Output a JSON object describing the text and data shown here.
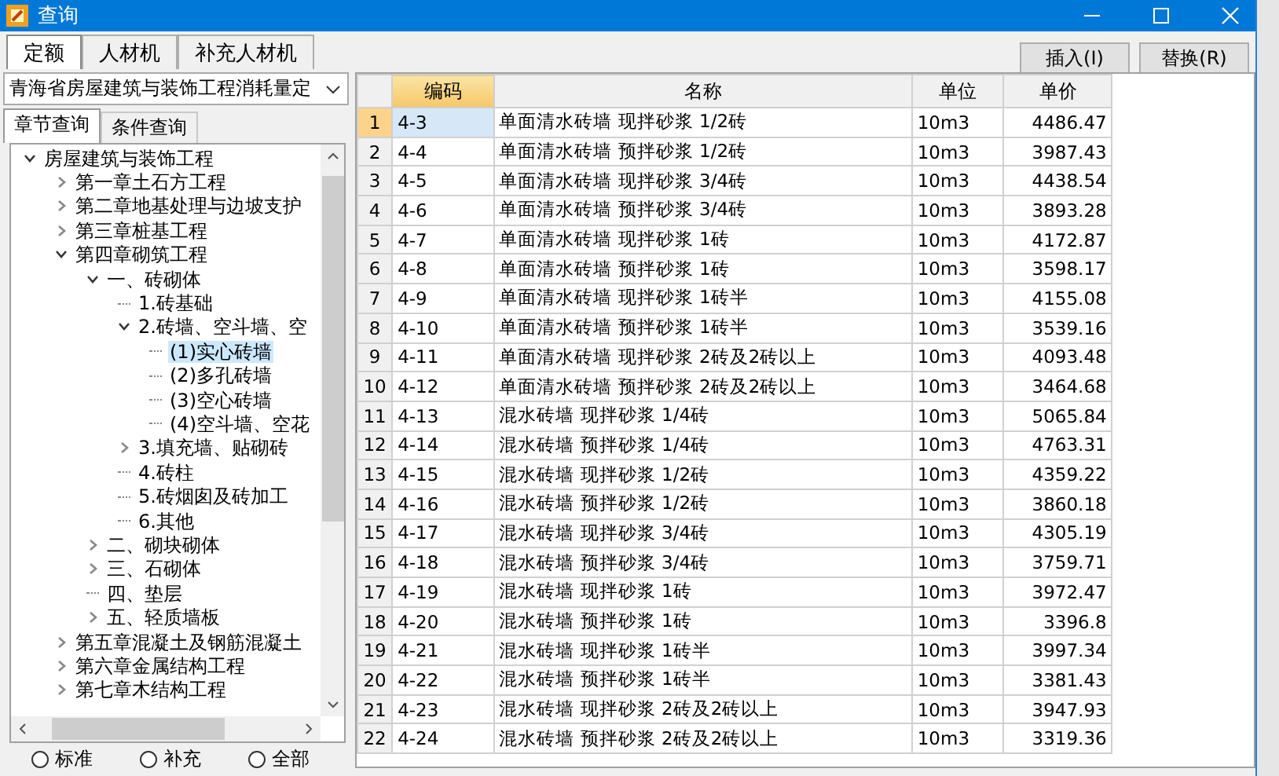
{
  "window": {
    "title": "查询"
  },
  "tabs": [
    {
      "label": "定额",
      "selected": true
    },
    {
      "label": "人材机",
      "selected": false
    },
    {
      "label": "补充人材机",
      "selected": false
    }
  ],
  "buttons": [
    "插入(I)",
    "替换(R)"
  ],
  "library_select": {
    "value": "青海省房屋建筑与装饰工程消耗量定"
  },
  "query_tabs": [
    {
      "label": "章节查询",
      "selected": true
    },
    {
      "label": "条件查询",
      "selected": false
    }
  ],
  "tree": [
    {
      "label": "房屋建筑与装饰工程",
      "expanded": true,
      "selected": false,
      "children": [
        {
          "label": "第一章土石方工程",
          "expanded": false,
          "selected": false
        },
        {
          "label": "第二章地基处理与边坡支护",
          "expanded": false,
          "selected": false
        },
        {
          "label": "第三章桩基工程",
          "expanded": false,
          "selected": false
        },
        {
          "label": "第四章砌筑工程",
          "expanded": true,
          "selected": false,
          "children": [
            {
              "label": "一、砖砌体",
              "expanded": true,
              "selected": false,
              "children": [
                {
                  "label": "1.砖基础",
                  "selected": false
                },
                {
                  "label": "2.砖墙、空斗墙、空",
                  "expanded": true,
                  "selected": false,
                  "children": [
                    {
                      "label": "(1)实心砖墙",
                      "selected": true
                    },
                    {
                      "label": "(2)多孔砖墙",
                      "selected": false
                    },
                    {
                      "label": "(3)空心砖墙",
                      "selected": false
                    },
                    {
                      "label": "(4)空斗墙、空花",
                      "selected": false
                    }
                  ]
                },
                {
                  "label": "3.填充墙、贴砌砖",
                  "expanded": false,
                  "selected": false
                },
                {
                  "label": "4.砖柱",
                  "selected": false
                },
                {
                  "label": "5.砖烟囱及砖加工",
                  "selected": false
                },
                {
                  "label": "6.其他",
                  "selected": false
                }
              ]
            },
            {
              "label": "二、砌块砌体",
              "expanded": false,
              "selected": false
            },
            {
              "label": "三、石砌体",
              "expanded": false,
              "selected": false
            },
            {
              "label": "四、垫层",
              "selected": false
            },
            {
              "label": "五、轻质墙板",
              "expanded": false,
              "selected": false
            }
          ]
        },
        {
          "label": "第五章混凝土及钢筋混凝土",
          "expanded": false,
          "selected": false
        },
        {
          "label": "第六章金属结构工程",
          "expanded": false,
          "selected": false
        },
        {
          "label": "第七章木结构工程",
          "expanded": false,
          "selected": false
        }
      ]
    }
  ],
  "filters": [
    {
      "label": "标准",
      "selected": false
    },
    {
      "label": "补充",
      "selected": false
    },
    {
      "label": "全部",
      "selected": false
    }
  ],
  "table": {
    "columns": [
      {
        "label": "编码",
        "selected": true
      },
      {
        "label": "名称",
        "selected": false
      },
      {
        "label": "单位",
        "selected": false
      },
      {
        "label": "单价",
        "selected": false
      }
    ],
    "rows": [
      {
        "index": "1",
        "code": "4-3",
        "name": "单面清水砖墙 现拌砂浆 1/2砖",
        "unit": "10m3",
        "price": "4486.47",
        "selected": true
      },
      {
        "index": "2",
        "code": "4-4",
        "name": "单面清水砖墙 预拌砂浆 1/2砖",
        "unit": "10m3",
        "price": "3987.43",
        "selected": false
      },
      {
        "index": "3",
        "code": "4-5",
        "name": "单面清水砖墙 现拌砂浆 3/4砖",
        "unit": "10m3",
        "price": "4438.54",
        "selected": false
      },
      {
        "index": "4",
        "code": "4-6",
        "name": "单面清水砖墙 预拌砂浆 3/4砖",
        "unit": "10m3",
        "price": "3893.28",
        "selected": false
      },
      {
        "index": "5",
        "code": "4-7",
        "name": "单面清水砖墙 现拌砂浆 1砖",
        "unit": "10m3",
        "price": "4172.87",
        "selected": false
      },
      {
        "index": "6",
        "code": "4-8",
        "name": "单面清水砖墙 预拌砂浆 1砖",
        "unit": "10m3",
        "price": "3598.17",
        "selected": false
      },
      {
        "index": "7",
        "code": "4-9",
        "name": "单面清水砖墙 现拌砂浆 1砖半",
        "unit": "10m3",
        "price": "4155.08",
        "selected": false
      },
      {
        "index": "8",
        "code": "4-10",
        "name": "单面清水砖墙 预拌砂浆 1砖半",
        "unit": "10m3",
        "price": "3539.16",
        "selected": false
      },
      {
        "index": "9",
        "code": "4-11",
        "name": "单面清水砖墙 现拌砂浆 2砖及2砖以上",
        "unit": "10m3",
        "price": "4093.48",
        "selected": false
      },
      {
        "index": "10",
        "code": "4-12",
        "name": "单面清水砖墙 预拌砂浆 2砖及2砖以上",
        "unit": "10m3",
        "price": "3464.68",
        "selected": false
      },
      {
        "index": "11",
        "code": "4-13",
        "name": "混水砖墙 现拌砂浆 1/4砖",
        "unit": "10m3",
        "price": "5065.84",
        "selected": false
      },
      {
        "index": "12",
        "code": "4-14",
        "name": "混水砖墙 预拌砂浆 1/4砖",
        "unit": "10m3",
        "price": "4763.31",
        "selected": false
      },
      {
        "index": "13",
        "code": "4-15",
        "name": "混水砖墙 现拌砂浆 1/2砖",
        "unit": "10m3",
        "price": "4359.22",
        "selected": false
      },
      {
        "index": "14",
        "code": "4-16",
        "name": "混水砖墙 预拌砂浆 1/2砖",
        "unit": "10m3",
        "price": "3860.18",
        "selected": false
      },
      {
        "index": "15",
        "code": "4-17",
        "name": "混水砖墙 现拌砂浆 3/4砖",
        "unit": "10m3",
        "price": "4305.19",
        "selected": false
      },
      {
        "index": "16",
        "code": "4-18",
        "name": "混水砖墙 预拌砂浆 3/4砖",
        "unit": "10m3",
        "price": "3759.71",
        "selected": false
      },
      {
        "index": "17",
        "code": "4-19",
        "name": "混水砖墙 现拌砂浆 1砖",
        "unit": "10m3",
        "price": "3972.47",
        "selected": false
      },
      {
        "index": "18",
        "code": "4-20",
        "name": "混水砖墙 预拌砂浆 1砖",
        "unit": "10m3",
        "price": "3396.8",
        "selected": false
      },
      {
        "index": "19",
        "code": "4-21",
        "name": "混水砖墙 现拌砂浆 1砖半",
        "unit": "10m3",
        "price": "3997.34",
        "selected": false
      },
      {
        "index": "20",
        "code": "4-22",
        "name": "混水砖墙 预拌砂浆 1砖半",
        "unit": "10m3",
        "price": "3381.43",
        "selected": false
      },
      {
        "index": "21",
        "code": "4-23",
        "name": "混水砖墙 现拌砂浆 2砖及2砖以上",
        "unit": "10m3",
        "price": "3947.93",
        "selected": false
      },
      {
        "index": "22",
        "code": "4-24",
        "name": "混水砖墙 预拌砂浆 2砖及2砖以上",
        "unit": "10m3",
        "price": "3319.36",
        "selected": false
      }
    ]
  }
}
